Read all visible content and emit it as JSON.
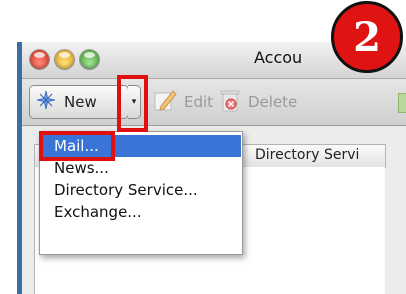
{
  "window": {
    "title": "Accou"
  },
  "toolbar": {
    "new_label": "New",
    "edit_label": "Edit",
    "delete_label": "Delete",
    "dropdown_arrow": "▾"
  },
  "table": {
    "column_header": "Directory Servi"
  },
  "menu": {
    "items": [
      "Mail...",
      "News...",
      "Directory Service...",
      "Exchange..."
    ],
    "selected": "Mail..."
  },
  "annotation": {
    "step_number": "2"
  },
  "colors": {
    "highlight": "#e01010",
    "selection": "#3875d7"
  },
  "icons": {
    "new": "sparkle-star-icon",
    "edit": "pencil-icon",
    "delete": "trash-icon"
  }
}
